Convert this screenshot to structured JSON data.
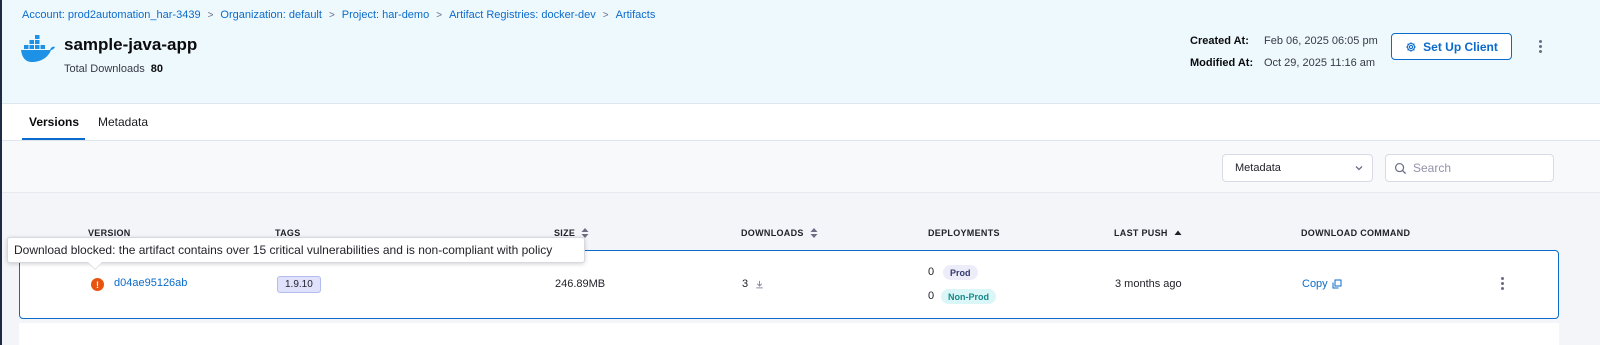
{
  "breadcrumb": [
    "Account: prod2automation_har-3439",
    "Organization: default",
    "Project: har-demo",
    "Artifact Registries: docker-dev",
    "Artifacts"
  ],
  "artifact": {
    "name": "sample-java-app",
    "icon": "docker-icon",
    "total_downloads_label": "Total Downloads",
    "total_downloads": "80",
    "created_label": "Created At:",
    "created_value": "Feb 06, 2025 06:05 pm",
    "modified_label": "Modified At:",
    "modified_value": "Oct 29, 2025 11:16 am"
  },
  "header": {
    "setup_client_label": "Set Up Client"
  },
  "tabs": [
    {
      "label": "Versions",
      "active": true
    },
    {
      "label": "Metadata",
      "active": false
    }
  ],
  "toolbar": {
    "filter_selected": "Metadata",
    "search_placeholder": "Search"
  },
  "table": {
    "columns": [
      "VERSION",
      "TAGS",
      "SIZE",
      "DOWNLOADS",
      "DEPLOYMENTS",
      "LAST PUSH",
      "DOWNLOAD COMMAND"
    ],
    "rows": [
      {
        "version": "d04ae95126ab",
        "tag": "1.9.10",
        "size": "246.89MB",
        "downloads": "3",
        "deployments": [
          {
            "count": "0",
            "env": "Prod"
          },
          {
            "count": "0",
            "env": "Non-Prod"
          }
        ],
        "last_push": "3 months ago",
        "download_command": "Copy"
      }
    ]
  },
  "tooltip": {
    "text": "Download blocked: the artifact contains over 15 critical vulnerabilities and is non-compliant with policy"
  },
  "colors": {
    "header_bg": "#eef9fe",
    "accent": "#0b6bcb",
    "warning": "#e8540f"
  }
}
